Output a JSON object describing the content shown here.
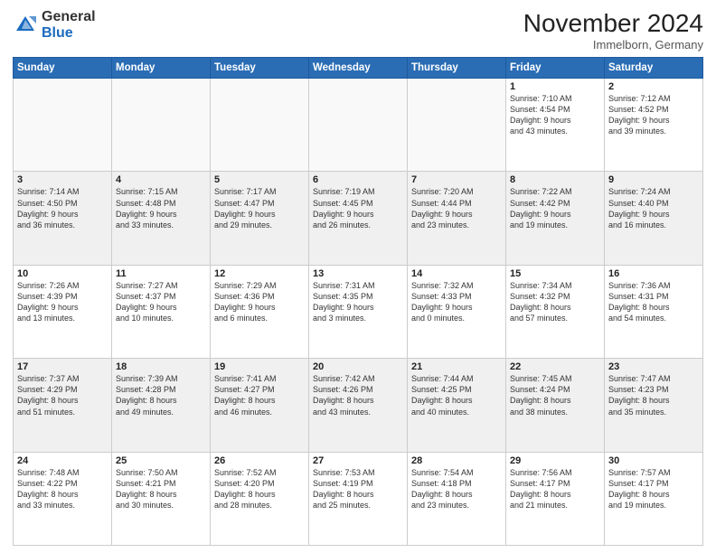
{
  "header": {
    "logo_general": "General",
    "logo_blue": "Blue",
    "month_title": "November 2024",
    "location": "Immelborn, Germany"
  },
  "calendar": {
    "days_of_week": [
      "Sunday",
      "Monday",
      "Tuesday",
      "Wednesday",
      "Thursday",
      "Friday",
      "Saturday"
    ],
    "weeks": [
      [
        {
          "day": "",
          "info": ""
        },
        {
          "day": "",
          "info": ""
        },
        {
          "day": "",
          "info": ""
        },
        {
          "day": "",
          "info": ""
        },
        {
          "day": "",
          "info": ""
        },
        {
          "day": "1",
          "info": "Sunrise: 7:10 AM\nSunset: 4:54 PM\nDaylight: 9 hours\nand 43 minutes."
        },
        {
          "day": "2",
          "info": "Sunrise: 7:12 AM\nSunset: 4:52 PM\nDaylight: 9 hours\nand 39 minutes."
        }
      ],
      [
        {
          "day": "3",
          "info": "Sunrise: 7:14 AM\nSunset: 4:50 PM\nDaylight: 9 hours\nand 36 minutes."
        },
        {
          "day": "4",
          "info": "Sunrise: 7:15 AM\nSunset: 4:48 PM\nDaylight: 9 hours\nand 33 minutes."
        },
        {
          "day": "5",
          "info": "Sunrise: 7:17 AM\nSunset: 4:47 PM\nDaylight: 9 hours\nand 29 minutes."
        },
        {
          "day": "6",
          "info": "Sunrise: 7:19 AM\nSunset: 4:45 PM\nDaylight: 9 hours\nand 26 minutes."
        },
        {
          "day": "7",
          "info": "Sunrise: 7:20 AM\nSunset: 4:44 PM\nDaylight: 9 hours\nand 23 minutes."
        },
        {
          "day": "8",
          "info": "Sunrise: 7:22 AM\nSunset: 4:42 PM\nDaylight: 9 hours\nand 19 minutes."
        },
        {
          "day": "9",
          "info": "Sunrise: 7:24 AM\nSunset: 4:40 PM\nDaylight: 9 hours\nand 16 minutes."
        }
      ],
      [
        {
          "day": "10",
          "info": "Sunrise: 7:26 AM\nSunset: 4:39 PM\nDaylight: 9 hours\nand 13 minutes."
        },
        {
          "day": "11",
          "info": "Sunrise: 7:27 AM\nSunset: 4:37 PM\nDaylight: 9 hours\nand 10 minutes."
        },
        {
          "day": "12",
          "info": "Sunrise: 7:29 AM\nSunset: 4:36 PM\nDaylight: 9 hours\nand 6 minutes."
        },
        {
          "day": "13",
          "info": "Sunrise: 7:31 AM\nSunset: 4:35 PM\nDaylight: 9 hours\nand 3 minutes."
        },
        {
          "day": "14",
          "info": "Sunrise: 7:32 AM\nSunset: 4:33 PM\nDaylight: 9 hours\nand 0 minutes."
        },
        {
          "day": "15",
          "info": "Sunrise: 7:34 AM\nSunset: 4:32 PM\nDaylight: 8 hours\nand 57 minutes."
        },
        {
          "day": "16",
          "info": "Sunrise: 7:36 AM\nSunset: 4:31 PM\nDaylight: 8 hours\nand 54 minutes."
        }
      ],
      [
        {
          "day": "17",
          "info": "Sunrise: 7:37 AM\nSunset: 4:29 PM\nDaylight: 8 hours\nand 51 minutes."
        },
        {
          "day": "18",
          "info": "Sunrise: 7:39 AM\nSunset: 4:28 PM\nDaylight: 8 hours\nand 49 minutes."
        },
        {
          "day": "19",
          "info": "Sunrise: 7:41 AM\nSunset: 4:27 PM\nDaylight: 8 hours\nand 46 minutes."
        },
        {
          "day": "20",
          "info": "Sunrise: 7:42 AM\nSunset: 4:26 PM\nDaylight: 8 hours\nand 43 minutes."
        },
        {
          "day": "21",
          "info": "Sunrise: 7:44 AM\nSunset: 4:25 PM\nDaylight: 8 hours\nand 40 minutes."
        },
        {
          "day": "22",
          "info": "Sunrise: 7:45 AM\nSunset: 4:24 PM\nDaylight: 8 hours\nand 38 minutes."
        },
        {
          "day": "23",
          "info": "Sunrise: 7:47 AM\nSunset: 4:23 PM\nDaylight: 8 hours\nand 35 minutes."
        }
      ],
      [
        {
          "day": "24",
          "info": "Sunrise: 7:48 AM\nSunset: 4:22 PM\nDaylight: 8 hours\nand 33 minutes."
        },
        {
          "day": "25",
          "info": "Sunrise: 7:50 AM\nSunset: 4:21 PM\nDaylight: 8 hours\nand 30 minutes."
        },
        {
          "day": "26",
          "info": "Sunrise: 7:52 AM\nSunset: 4:20 PM\nDaylight: 8 hours\nand 28 minutes."
        },
        {
          "day": "27",
          "info": "Sunrise: 7:53 AM\nSunset: 4:19 PM\nDaylight: 8 hours\nand 25 minutes."
        },
        {
          "day": "28",
          "info": "Sunrise: 7:54 AM\nSunset: 4:18 PM\nDaylight: 8 hours\nand 23 minutes."
        },
        {
          "day": "29",
          "info": "Sunrise: 7:56 AM\nSunset: 4:17 PM\nDaylight: 8 hours\nand 21 minutes."
        },
        {
          "day": "30",
          "info": "Sunrise: 7:57 AM\nSunset: 4:17 PM\nDaylight: 8 hours\nand 19 minutes."
        }
      ]
    ]
  }
}
